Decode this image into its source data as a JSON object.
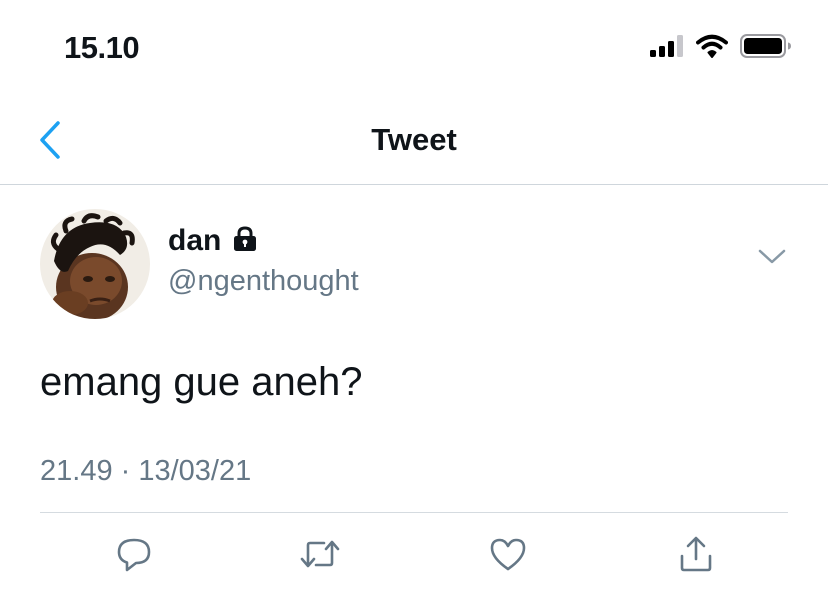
{
  "status_bar": {
    "time": "15.10",
    "icons": [
      "cellular-signal-icon",
      "wifi-icon",
      "battery-icon"
    ]
  },
  "nav": {
    "title": "Tweet",
    "back_icon": "chevron-left-icon"
  },
  "tweet": {
    "display_name": "dan",
    "protected_icon": "lock-icon",
    "handle": "@ngenthought",
    "text": "emang gue aneh?",
    "timestamp": "21.49 · 13/03/21",
    "menu_icon": "chevron-down-icon"
  },
  "actions": [
    {
      "name": "reply",
      "icon": "reply-icon"
    },
    {
      "name": "retweet",
      "icon": "retweet-icon"
    },
    {
      "name": "like",
      "icon": "heart-icon"
    },
    {
      "name": "share",
      "icon": "share-icon"
    }
  ],
  "colors": {
    "accent": "#1da1f2",
    "text": "#0f1419",
    "secondary": "#657786",
    "divider": "#d5dbe0"
  }
}
